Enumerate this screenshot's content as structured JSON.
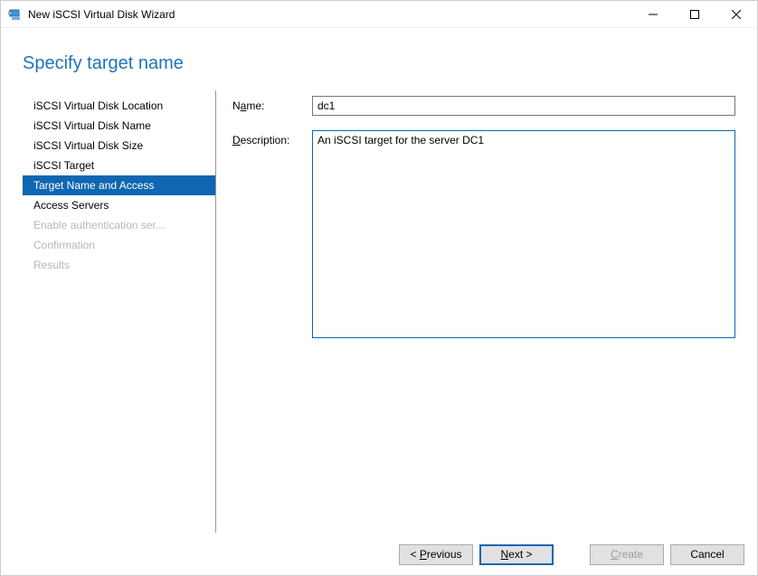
{
  "titlebar": {
    "title": "New iSCSI Virtual Disk Wizard"
  },
  "header": {
    "title": "Specify target name"
  },
  "sidebar": {
    "items": [
      {
        "label": "iSCSI Virtual Disk Location",
        "state": "normal"
      },
      {
        "label": "iSCSI Virtual Disk Name",
        "state": "normal"
      },
      {
        "label": "iSCSI Virtual Disk Size",
        "state": "normal"
      },
      {
        "label": "iSCSI Target",
        "state": "normal"
      },
      {
        "label": "Target Name and Access",
        "state": "selected"
      },
      {
        "label": "Access Servers",
        "state": "normal"
      },
      {
        "label": "Enable authentication ser...",
        "state": "disabled"
      },
      {
        "label": "Confirmation",
        "state": "disabled"
      },
      {
        "label": "Results",
        "state": "disabled"
      }
    ]
  },
  "form": {
    "name_label": "Name:",
    "name_value": "dc1",
    "description_label": "Description:",
    "description_value": "An iSCSI target for the server DC1"
  },
  "buttons": {
    "previous": "< Previous",
    "next": "Next >",
    "create": "Create",
    "cancel": "Cancel"
  }
}
